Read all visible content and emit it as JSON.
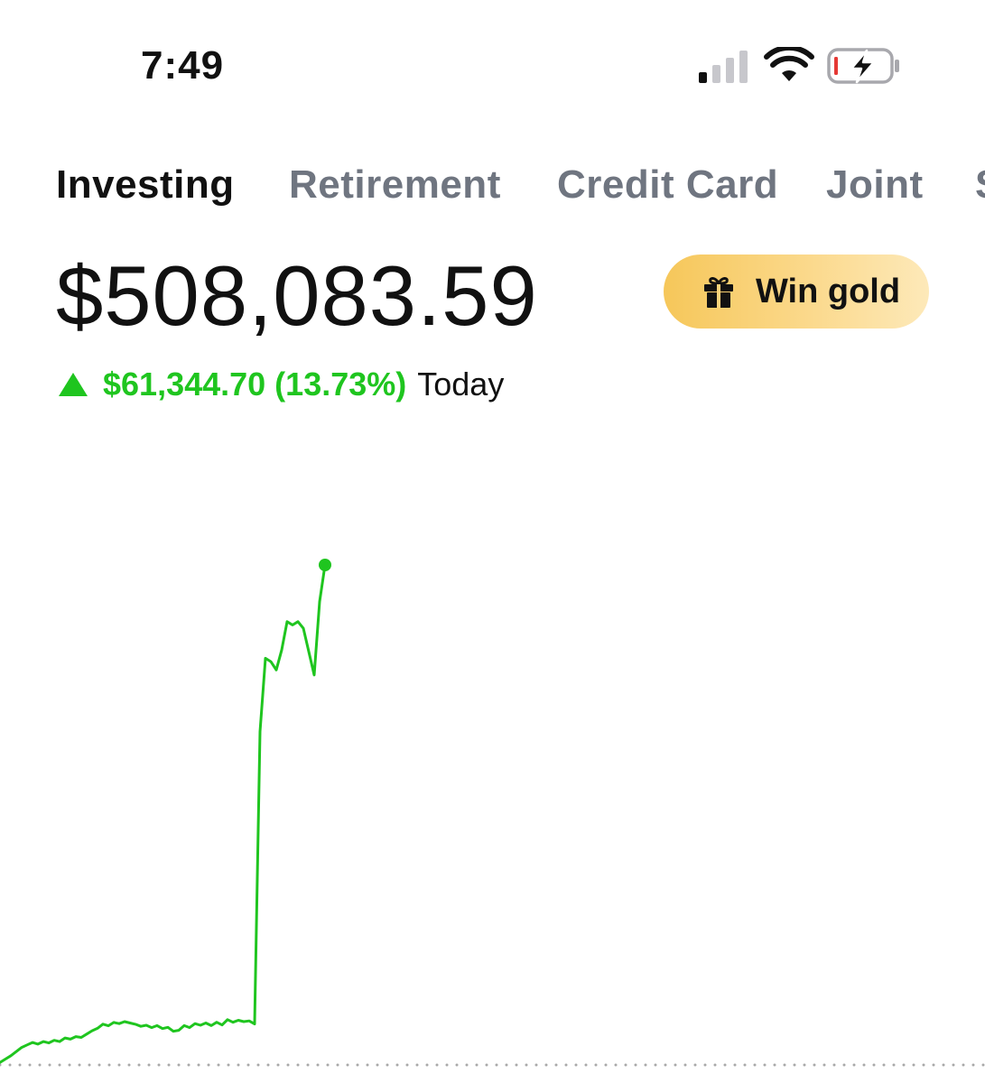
{
  "status_bar": {
    "time": "7:49"
  },
  "tabs": [
    {
      "label": "Investing",
      "active": true
    },
    {
      "label": "Retirement",
      "active": false
    },
    {
      "label": "Credit Card",
      "active": false
    },
    {
      "label": "Joint",
      "active": false
    },
    {
      "label": "S",
      "active": false
    }
  ],
  "portfolio": {
    "value": "$508,083.59",
    "change": "$61,344.70 (13.73%)",
    "period": "Today"
  },
  "promo": {
    "label": "Win gold",
    "icon": "gift-icon"
  },
  "colors": {
    "positive": "#1fc51f",
    "gold": "#f6c75a",
    "inactive_tab": "#6f7580"
  },
  "chart_data": {
    "type": "line",
    "title": "",
    "xlabel": "",
    "ylabel": "",
    "grid": false,
    "baseline": "dotted",
    "series": [
      {
        "values": [
          0,
          1.5,
          3.5,
          5.5,
          8.0,
          10.5,
          12.0,
          13.5,
          12.5,
          14.0,
          13.2,
          14.8,
          14.0,
          16.2,
          15.5,
          17.0,
          16.5,
          18.5,
          20.5,
          22.0,
          24.5,
          23.5,
          25.5,
          24.8,
          26.0,
          25.2,
          24.4,
          23.2,
          23.8,
          22.4,
          23.6,
          21.8,
          22.6,
          20.2,
          20.8,
          23.6,
          22.4,
          24.8,
          23.8,
          25.2,
          23.6,
          25.6,
          24.0,
          27.2,
          25.6,
          26.8,
          26.0,
          26.4,
          24.6,
          200,
          244,
          242,
          237,
          249,
          266,
          264,
          266,
          262,
          248,
          234,
          278,
          300
        ]
      }
    ]
  }
}
